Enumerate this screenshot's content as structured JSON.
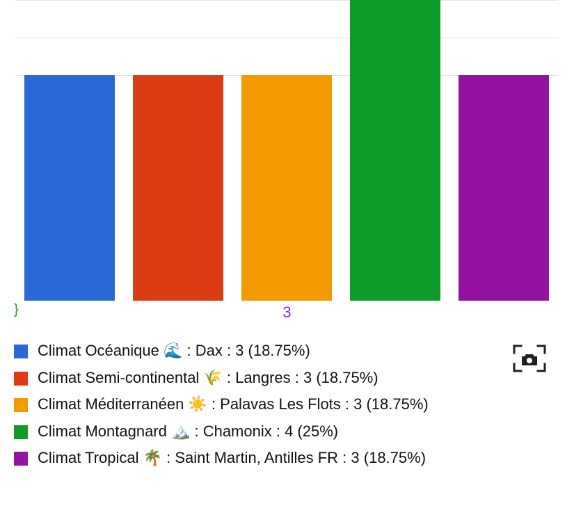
{
  "chart_data": {
    "type": "bar",
    "title": "",
    "xlabel": "",
    "ylabel": "",
    "ylim": [
      0,
      4
    ],
    "x_axis_tick_visible": "3",
    "categories": [
      "Climat Océanique 🌊 : Dax",
      "Climat Semi-continental 🌾 : Langres",
      "Climat Méditerranéen ☀️ : Palavas Les Flots",
      "Climat Montagnard 🏔️ : Chamonix",
      "Climat Tropical 🌴 : Saint Martin, Antilles FR"
    ],
    "values": [
      3,
      3,
      3,
      4,
      3
    ],
    "percentages": [
      18.75,
      18.75,
      18.75,
      25,
      18.75
    ],
    "colors": [
      "#2a68d8",
      "#dc3c13",
      "#f29a00",
      "#0f9b28",
      "#9313a0"
    ],
    "gridlines_y": [
      3,
      3.5,
      4
    ]
  },
  "legend": {
    "items": [
      {
        "color": "#2a68d8",
        "label": "Climat Océanique 🌊 : Dax : 3 (18.75%)"
      },
      {
        "color": "#dc3c13",
        "label": "Climat Semi-continental 🌾 : Langres : 3 (18.75%)"
      },
      {
        "color": "#f29a00",
        "label": "Climat Méditerranéen ☀️ : Palavas Les Flots : 3 (18.75%)"
      },
      {
        "color": "#0f9b28",
        "label": "Climat Montagnard 🏔️ : Chamonix : 4 (25%)"
      },
      {
        "color": "#9313a0",
        "label": "Climat Tropical 🌴 : Saint Martin, Antilles FR : 3 (18.75%)"
      }
    ]
  },
  "icons": {
    "screenshot": "screenshot-camera-icon"
  }
}
